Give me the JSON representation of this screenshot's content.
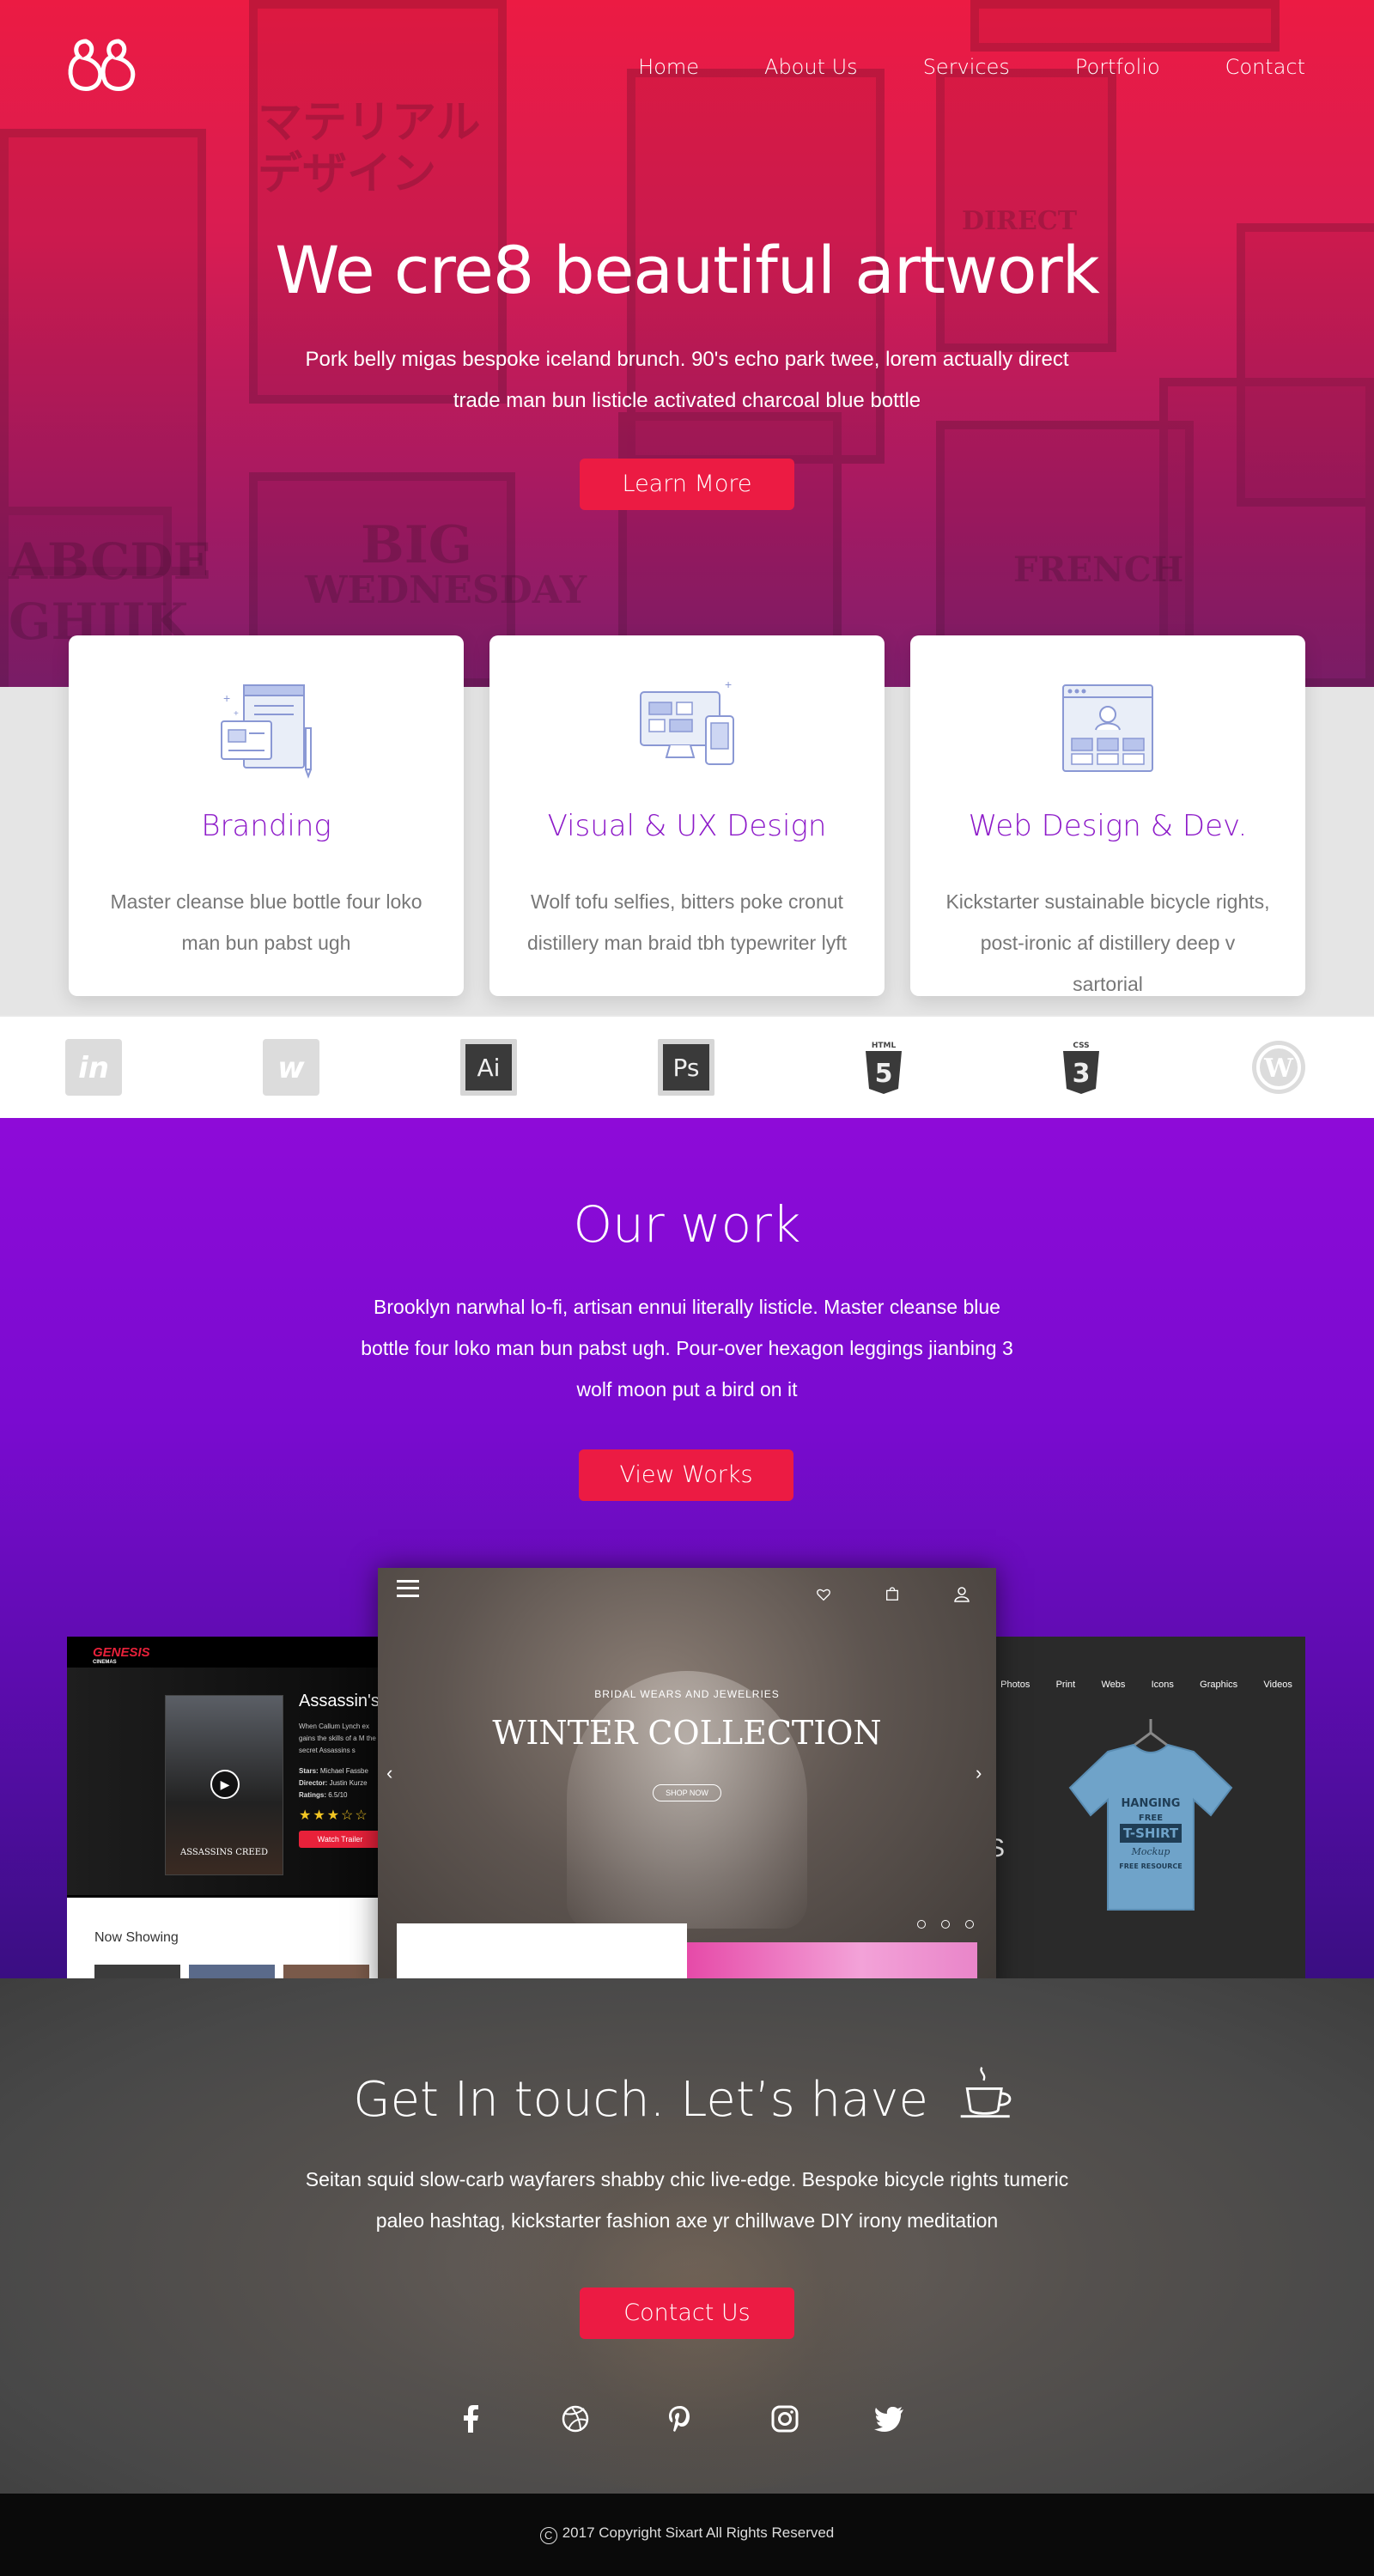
{
  "nav": {
    "items": [
      "Home",
      "About Us",
      "Services",
      "Portfolio",
      "Contact"
    ]
  },
  "hero": {
    "title": "We cre8 beautiful artwork",
    "subtitle": "Pork belly migas bespoke iceland brunch. 90's echo park twee, lorem actually direct trade man bun listicle activated charcoal blue bottle",
    "button": "Learn More",
    "bg_text": [
      "マテリアル",
      "デザイン",
      "ABCDE",
      "GHIJK",
      "BIG",
      "WEDNESDAY",
      "FRENCH",
      "DIRECT"
    ]
  },
  "services": [
    {
      "title": "Branding",
      "desc": "Master cleanse blue bottle four loko man bun pabst ugh",
      "icon": "branding-icon"
    },
    {
      "title": "Visual & UX Design",
      "desc": "Wolf tofu selfies, bitters poke cronut distillery man braid tbh typewriter lyft",
      "icon": "devices-icon"
    },
    {
      "title": "Web Design & Dev.",
      "desc": "Kickstarter sustainable bicycle rights, post-ironic af distillery deep v sartorial",
      "icon": "web-layout-icon"
    }
  ],
  "tools": [
    {
      "name": "invision-icon",
      "label": "in"
    },
    {
      "name": "webflow-icon",
      "label": "w"
    },
    {
      "name": "illustrator-icon",
      "label": "Ai"
    },
    {
      "name": "photoshop-icon",
      "label": "Ps"
    },
    {
      "name": "html5-icon",
      "label": "5",
      "top": "HTML"
    },
    {
      "name": "css3-icon",
      "label": "3",
      "top": "CSS"
    },
    {
      "name": "wordpress-icon",
      "label": "W"
    }
  ],
  "work": {
    "title": "Our work",
    "subtitle": "Brooklyn narwhal lo-fi, artisan ennui literally listicle. Master cleanse blue bottle four loko man bun pabst ugh. Pour-over hexagon leggings jianbing 3 wolf moon put a bird on it",
    "button": "View Works",
    "left_shot": {
      "brand": "GENESIS",
      "brand_sub": "CINEMAS",
      "movie_title": "Assassin's",
      "blurb": "When Callum Lynch ex gains the skills of a M the secret Assassins s",
      "stars_label": "Stars:",
      "stars_value": "Michael Fassbe",
      "director_label": "Director:",
      "director_value": "Justin Kurze",
      "ratings_label": "Ratings:",
      "ratings_value": "6.5/10",
      "trailer_button": "Watch Trailer",
      "now_showing": "Now Showing",
      "poster_text": "ASSASSINS CREED"
    },
    "center_shot": {
      "kicker": "BRIDAL WEARS AND JEWELRIES",
      "title": "WINTER COLLECTION",
      "button": "SHOP NOW"
    },
    "right_shot": {
      "menu": [
        "Photos",
        "Print",
        "Webs",
        "Icons",
        "Graphics",
        "Videos"
      ],
      "shirt_text": [
        "HANGING",
        "FREE",
        "T-SHIRT",
        "Mockup",
        "FREE RESOURCE"
      ],
      "side_letter": "S"
    }
  },
  "contact": {
    "title": "Get In touch. Let’s have",
    "subtitle": "Seitan squid slow-carb wayfarers shabby chic live-edge. Bespoke bicycle rights tumeric paleo hashtag, kickstarter fashion axe yr chillwave DIY irony meditation",
    "button": "Contact Us",
    "social": [
      "facebook-icon",
      "dribbble-icon",
      "pinterest-icon",
      "instagram-icon",
      "twitter-icon"
    ]
  },
  "footer": {
    "copyright": "2017 Copyright Sixart All Rights Reserved"
  },
  "colors": {
    "accent": "#ec1b43",
    "service_title": "#8d1bc9",
    "work_bg_top": "#8e0bd8",
    "work_bg_bottom": "#3a0e82"
  }
}
